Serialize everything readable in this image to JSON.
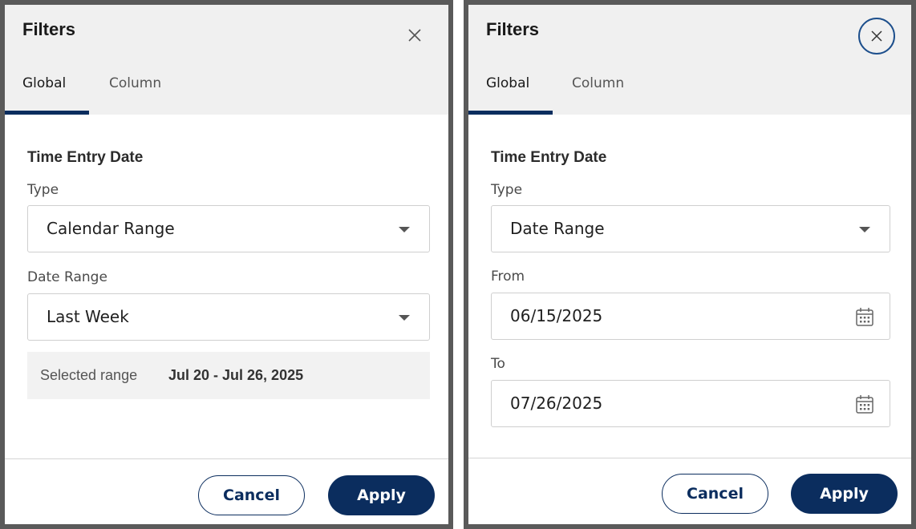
{
  "left_panel": {
    "title": "Filters",
    "tabs": [
      {
        "label": "Global",
        "active": true
      },
      {
        "label": "Column",
        "active": false
      }
    ],
    "section_title": "Time Entry Date",
    "type_label": "Type",
    "type_value": "Calendar Range",
    "date_range_label": "Date Range",
    "date_range_value": "Last Week",
    "selected_range_label": "Selected range",
    "selected_range_value": "Jul 20 - Jul 26, 2025",
    "cancel_label": "Cancel",
    "apply_label": "Apply",
    "close_icon": "close-icon"
  },
  "right_panel": {
    "title": "Filters",
    "tabs": [
      {
        "label": "Global",
        "active": true
      },
      {
        "label": "Column",
        "active": false
      }
    ],
    "section_title": "Time Entry Date",
    "type_label": "Type",
    "type_value": "Date Range",
    "from_label": "From",
    "from_value": "06/15/2025",
    "to_label": "To",
    "to_value": "07/26/2025",
    "cancel_label": "Cancel",
    "apply_label": "Apply",
    "close_icon": "close-circle-icon",
    "calendar_icon": "calendar-icon"
  },
  "colors": {
    "primary": "#0b2d5e",
    "header_bg": "#f0f0f0",
    "frame": "#5a5a5a",
    "focus_ring": "#1d4f8c"
  }
}
